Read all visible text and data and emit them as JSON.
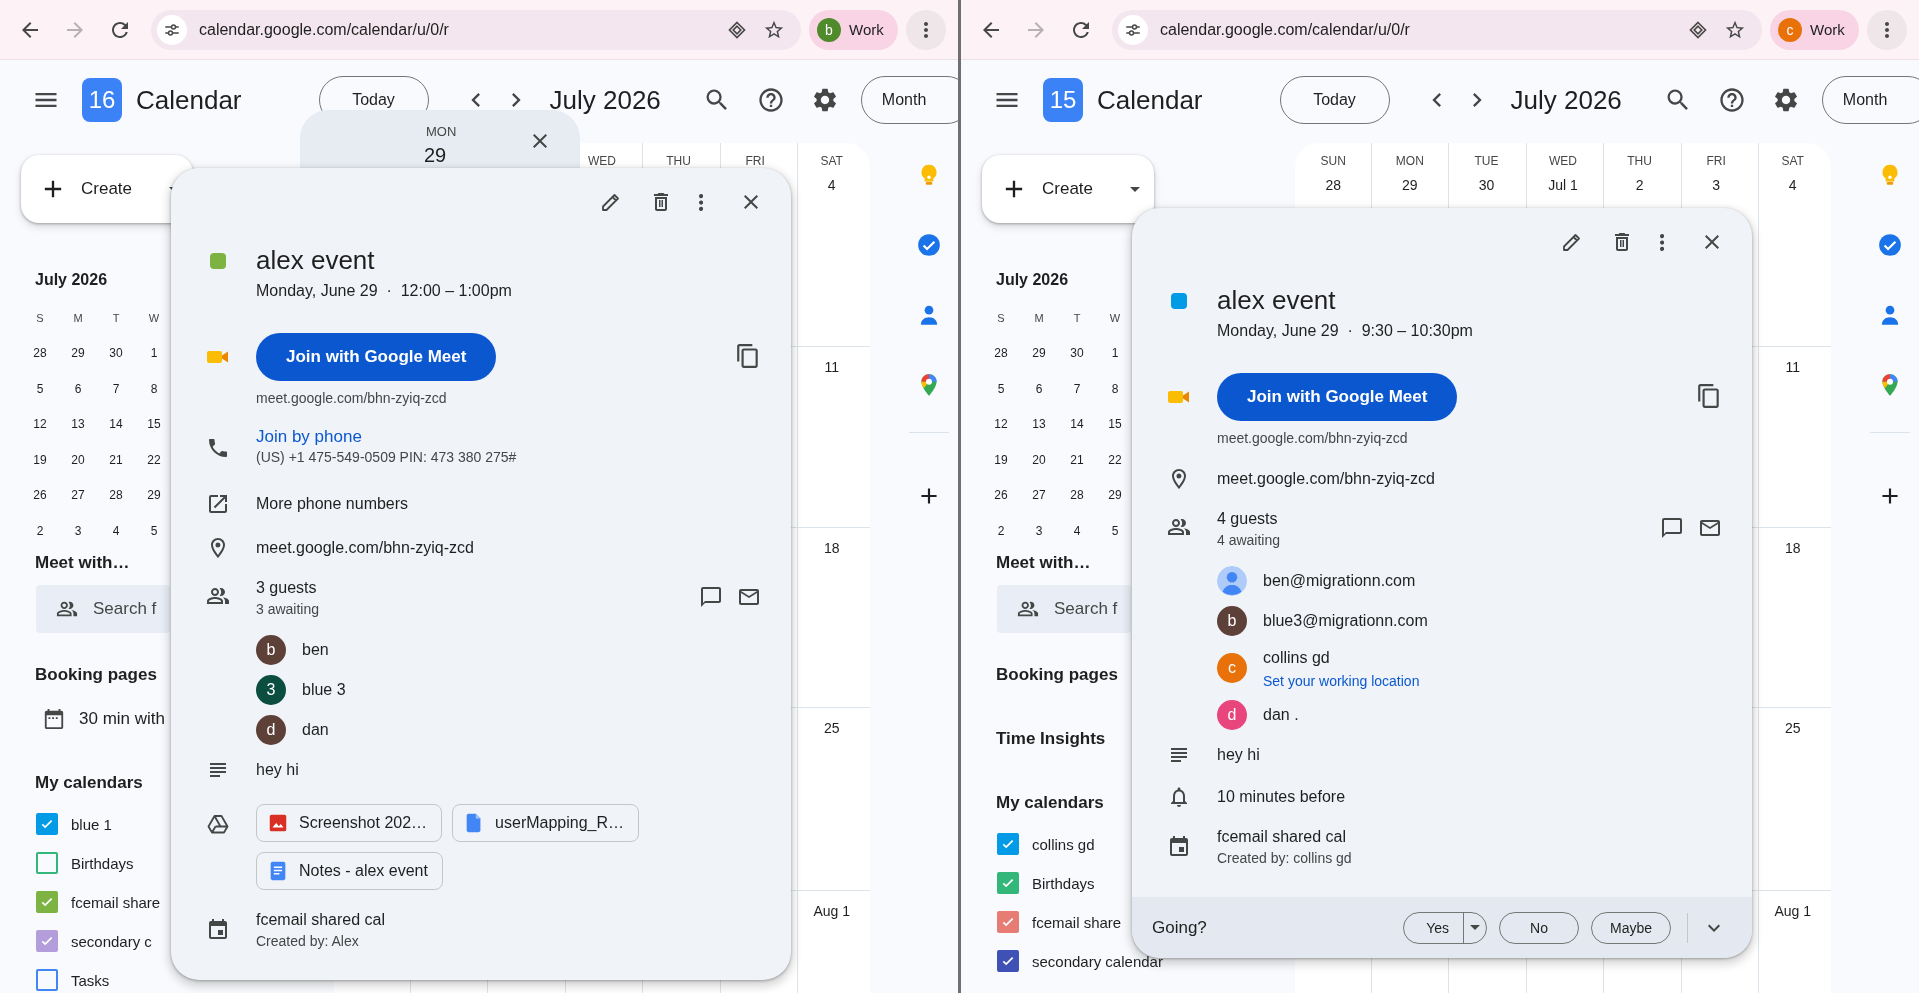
{
  "windows": [
    {
      "browser": {
        "url": "calendar.google.com/calendar/u/0/r",
        "profile": {
          "initial": "b",
          "label": "Work",
          "color": "#4f8a2b"
        }
      },
      "header": {
        "logo_date": "16",
        "app_name": "Calendar",
        "today": "Today",
        "period": "July 2026",
        "view": "Month"
      },
      "sidebar": {
        "create": "Create",
        "mini_calendar": {
          "title": "July 2026",
          "weekdays": [
            "S",
            "M",
            "T",
            "W"
          ],
          "weeks": [
            [
              "28",
              "29",
              "30",
              "1"
            ],
            [
              "5",
              "6",
              "7",
              "8"
            ],
            [
              "12",
              "13",
              "14",
              "15"
            ],
            [
              "19",
              "20",
              "21",
              "22"
            ],
            [
              "26",
              "27",
              "28",
              "29"
            ],
            [
              "2",
              "3",
              "4",
              "5"
            ]
          ]
        },
        "meet_with": {
          "title": "Meet with…",
          "placeholder": "Search f"
        },
        "sections": [
          {
            "title": "Booking pages",
            "items": [
              "30 min with"
            ]
          },
          {
            "title": "My calendars",
            "calendars": [
              {
                "label": "blue 1",
                "checked": true,
                "color": "#039be5"
              },
              {
                "label": "Birthdays",
                "checked": false,
                "color": "#33b679"
              },
              {
                "label": "fcemail share",
                "checked": true,
                "color": "#7cb342"
              },
              {
                "label": "secondary c",
                "checked": true,
                "color": "#b39ddb"
              },
              {
                "label": "Tasks",
                "checked": false,
                "color": "#4285f4"
              }
            ]
          }
        ]
      },
      "day_card": {
        "day": "MON",
        "date": "29"
      },
      "grid": {
        "columns": [
          {
            "day": "WED"
          },
          {
            "day": "THU"
          },
          {
            "day": "FRI"
          },
          {
            "day": "SAT",
            "date": "4"
          }
        ],
        "weeks": [
          {
            "saturday": "11"
          },
          {
            "saturday": "18"
          },
          {
            "saturday": "25"
          },
          {
            "saturday": "Aug 1"
          }
        ]
      },
      "popup": {
        "color": "#7cb342",
        "title": "alex event",
        "when": "Monday, June 29  ·  12:00 – 1:00pm",
        "rows": [
          {
            "kind": "meet",
            "button": "Join with Google Meet",
            "link": "meet.google.com/bhn-zyiq-zcd"
          },
          {
            "kind": "phone",
            "link": "Join by phone",
            "detail": "(US) +1 475-549-0509 PIN: 473 380 275#"
          },
          {
            "kind": "more_numbers",
            "text": "More phone numbers"
          },
          {
            "kind": "location",
            "text": "meet.google.com/bhn-zyiq-zcd"
          },
          {
            "kind": "guests",
            "count": "3 guests",
            "status": "3 awaiting",
            "guests": [
              {
                "kind": "letter",
                "initial": "b",
                "color": "#5d4037",
                "name": "ben"
              },
              {
                "kind": "letter",
                "initial": "3",
                "color": "#0b4d3e",
                "name": "blue 3"
              },
              {
                "kind": "letter",
                "initial": "d",
                "color": "#5d4037",
                "name": "dan"
              }
            ]
          },
          {
            "kind": "description",
            "text": "hey hi"
          },
          {
            "kind": "attachments",
            "files": [
              {
                "kind": "image",
                "name": "Screenshot 202…"
              },
              {
                "kind": "file",
                "name": "userMapping_R…"
              },
              {
                "kind": "notes",
                "name": "Notes - alex event"
              }
            ]
          },
          {
            "kind": "calendar",
            "text": "fcemail shared cal",
            "detail": "Created by: Alex"
          }
        ]
      }
    },
    {
      "browser": {
        "url": "calendar.google.com/calendar/u/0/r",
        "profile": {
          "initial": "c",
          "label": "Work",
          "color": "#e8710a"
        }
      },
      "header": {
        "logo_date": "15",
        "app_name": "Calendar",
        "today": "Today",
        "period": "July 2026",
        "view": "Month"
      },
      "sidebar": {
        "create": "Create",
        "mini_calendar": {
          "title": "July 2026",
          "weekdays": [
            "S",
            "M",
            "T",
            "W"
          ],
          "weeks": [
            [
              "28",
              "29",
              "30",
              "1"
            ],
            [
              "5",
              "6",
              "7",
              "8"
            ],
            [
              "12",
              "13",
              "14",
              "15"
            ],
            [
              "19",
              "20",
              "21",
              "22"
            ],
            [
              "26",
              "27",
              "28",
              "29"
            ],
            [
              "2",
              "3",
              "4",
              "5"
            ]
          ]
        },
        "meet_with": {
          "title": "Meet with…",
          "placeholder": "Search f"
        },
        "sections": [
          {
            "title": "Booking pages"
          },
          {
            "title": "Time Insights"
          },
          {
            "title": "My calendars",
            "calendars": [
              {
                "label": "collins gd",
                "checked": true,
                "color": "#039be5"
              },
              {
                "label": "Birthdays",
                "checked": true,
                "color": "#33b679"
              },
              {
                "label": "fcemail share",
                "checked": true,
                "color": "#e67c73"
              },
              {
                "label": "secondary calendar",
                "checked": true,
                "color": "#3f51b5"
              }
            ]
          }
        ]
      },
      "grid": {
        "columns": [
          {
            "day": "SUN",
            "date": "28"
          },
          {
            "day": "MON",
            "date": "29"
          },
          {
            "day": "TUE",
            "date": "30"
          },
          {
            "day": "WED",
            "date": "Jul 1"
          },
          {
            "day": "THU",
            "date": "2"
          },
          {
            "day": "FRI",
            "date": "3"
          },
          {
            "day": "SAT",
            "date": "4"
          }
        ],
        "weeks": [
          {
            "saturday": "11"
          },
          {
            "saturday": "18"
          },
          {
            "saturday": "25"
          },
          {
            "saturday": "Aug 1"
          }
        ]
      },
      "popup": {
        "color": "#039be5",
        "title": "alex event",
        "when": "Monday, June 29  ·  9:30 – 10:30pm",
        "rows": [
          {
            "kind": "meet",
            "button": "Join with Google Meet",
            "link": "meet.google.com/bhn-zyiq-zcd"
          },
          {
            "kind": "location",
            "text": "meet.google.com/bhn-zyiq-zcd"
          },
          {
            "kind": "guests",
            "count": "4 guests",
            "status": "4 awaiting",
            "guests": [
              {
                "kind": "silhouette",
                "name": "ben@migrationn.com"
              },
              {
                "kind": "letter",
                "initial": "b",
                "color": "#5d4037",
                "name": "blue3@migrationn.com"
              },
              {
                "kind": "letter",
                "initial": "c",
                "color": "#e8710a",
                "name": "collins gd",
                "link": "Set your working location"
              },
              {
                "kind": "letter",
                "initial": "d",
                "color": "#e8457c",
                "name": "dan ."
              }
            ]
          },
          {
            "kind": "description",
            "text": "hey hi"
          },
          {
            "kind": "reminder",
            "text": "10 minutes before"
          },
          {
            "kind": "calendar",
            "text": "fcemail shared cal",
            "detail": "Created by: collins gd"
          }
        ],
        "rsvp": {
          "label": "Going?",
          "options": [
            {
              "label": "Yes",
              "kind": "split",
              "selected": false
            },
            {
              "label": "No",
              "kind": "plain",
              "selected": false
            },
            {
              "label": "Maybe",
              "kind": "plain",
              "selected": false
            }
          ]
        }
      }
    }
  ]
}
